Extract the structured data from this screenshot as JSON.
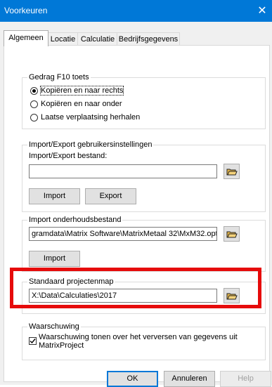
{
  "window": {
    "title": "Voorkeuren",
    "close_glyph": "✕"
  },
  "tabs": [
    {
      "label": "Algemeen",
      "active": true
    },
    {
      "label": "Locatie",
      "active": false
    },
    {
      "label": "Calculatie",
      "active": false
    },
    {
      "label": "Bedrijfsgegevens",
      "active": false
    }
  ],
  "f10_group": {
    "legend": "Gedrag F10 toets",
    "options": [
      {
        "label": "Kopiëren en naar rechts",
        "selected": true
      },
      {
        "label": "Kopiëren en naar onder",
        "selected": false
      },
      {
        "label": "Laatse verplaatsing herhalen",
        "selected": false
      }
    ]
  },
  "import_export_group": {
    "legend": "Import/Export gebruikersinstellingen",
    "field_label": "Import/Export bestand:",
    "field_value": "",
    "import_label": "Import",
    "export_label": "Export"
  },
  "maintenance_group": {
    "legend": "Import onderhoudsbestand",
    "field_value": "gramdata\\Matrix Software\\MatrixMetaal 32\\MxM32.opt",
    "import_label": "Import"
  },
  "projects_group": {
    "legend": "Standaard projectenmap",
    "field_value": "X:\\Data\\Calculaties\\2017",
    "highlight_color": "#e60b0b"
  },
  "warning_group": {
    "legend": "Waarschuwing",
    "checkbox_checked": true,
    "checkbox_label_line1": "Waarschuwing tonen over het verversen van gegevens uit",
    "checkbox_label_line2": "MatrixProject"
  },
  "footer": {
    "ok_label": "OK",
    "cancel_label": "Annuleren",
    "help_label": "Help"
  },
  "colors": {
    "titlebar": "#0078d7",
    "dialog_bg": "#f0f0f0"
  }
}
